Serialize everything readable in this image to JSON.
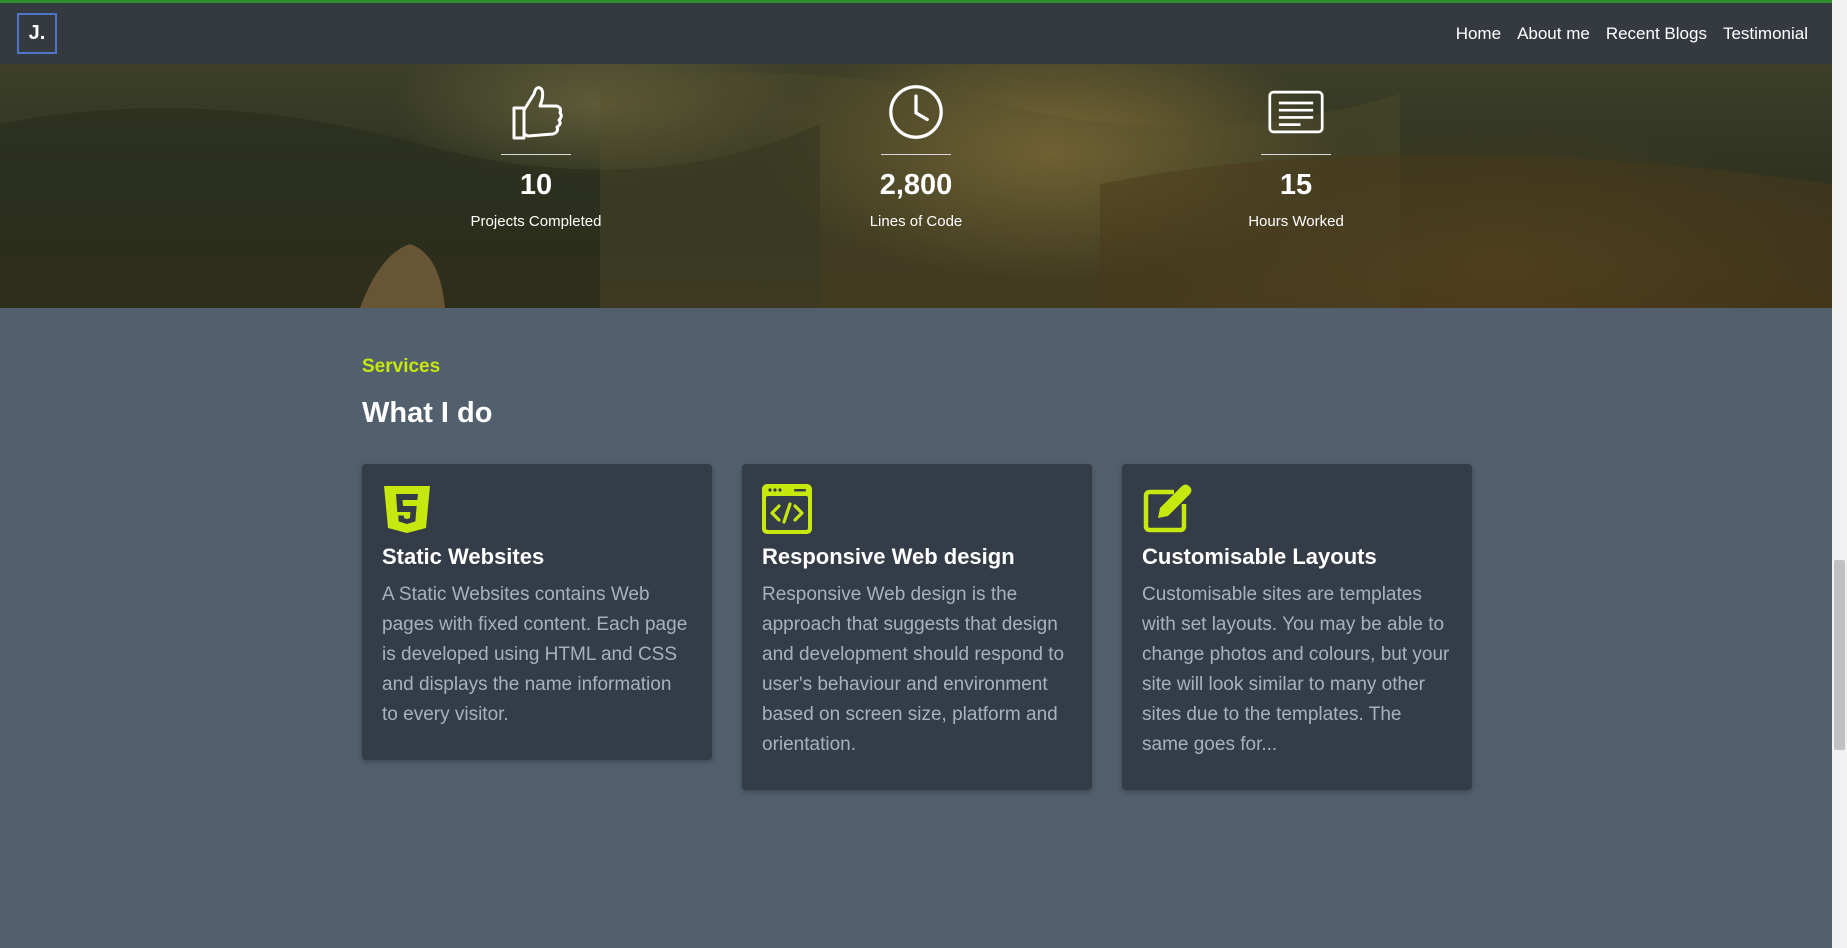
{
  "nav": {
    "logo": "J.",
    "links": [
      "Home",
      "About me",
      "Recent Blogs",
      "Testimonial"
    ]
  },
  "stats": [
    {
      "icon": "thumbs-up-icon",
      "value": "10",
      "label": "Projects Completed"
    },
    {
      "icon": "clock-icon",
      "value": "2,800",
      "label": "Lines of Code"
    },
    {
      "icon": "document-icon",
      "value": "15",
      "label": "Hours Worked"
    }
  ],
  "services": {
    "subtitle": "Services",
    "title": "What I do",
    "cards": [
      {
        "icon": "html5-icon",
        "title": "Static Websites",
        "text": "A Static Websites contains Web pages with fixed content. Each page is developed using HTML and CSS and displays the name information to every visitor."
      },
      {
        "icon": "code-window-icon",
        "title": "Responsive Web design",
        "text": "Responsive Web design is the approach that suggests that design and development should respond to user's behaviour and environment based on screen size, platform and orientation."
      },
      {
        "icon": "edit-icon",
        "title": "Customisable Layouts",
        "text": "Customisable sites are templates with set layouts. You may be able to change photos and colours, but your site will look similar to many other sites due to the templates. The same goes for..."
      }
    ]
  },
  "colors": {
    "accent": "#c6e80e",
    "navbar": "#343a40",
    "section_bg": "#525f6d",
    "card_bg": "#333c47"
  }
}
